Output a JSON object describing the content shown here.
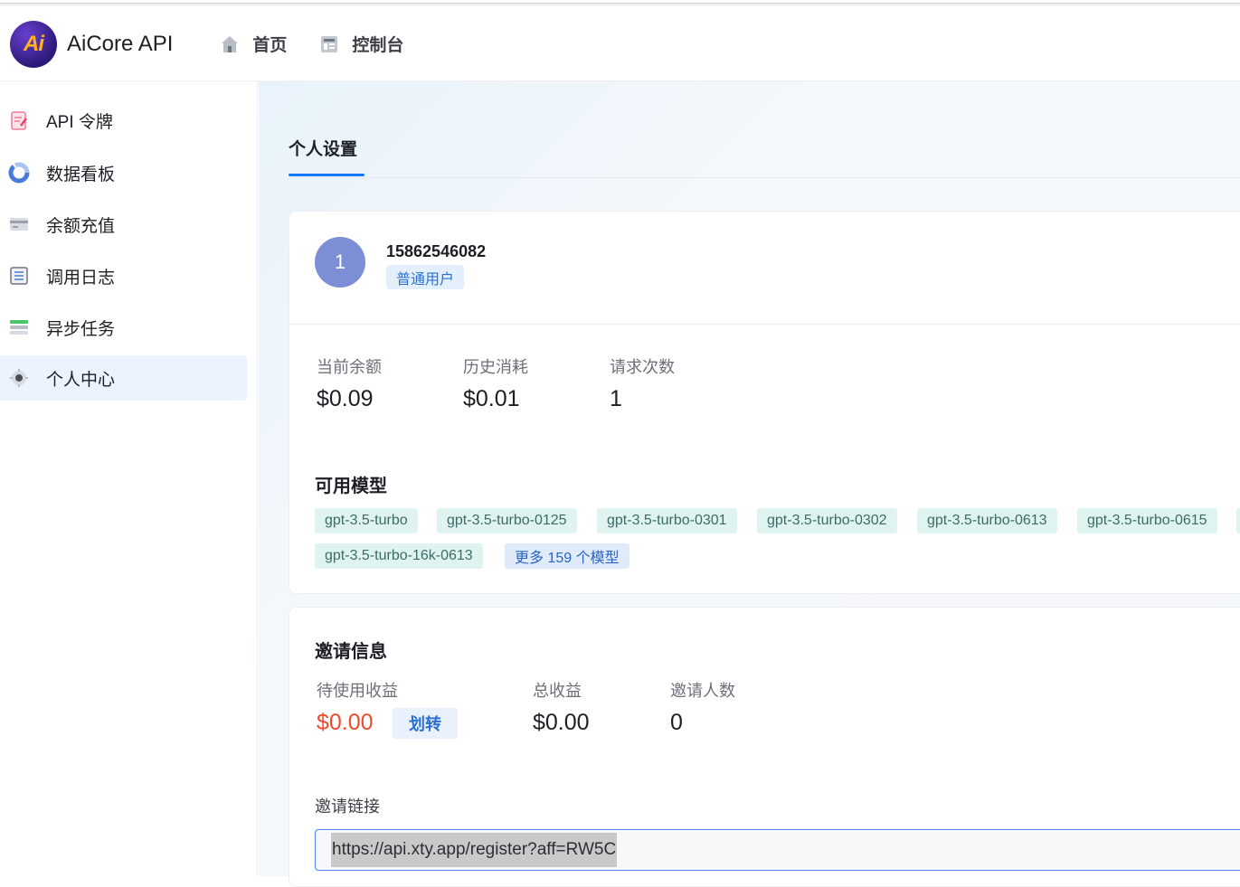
{
  "header": {
    "logo_text": "Ai",
    "brand": "AiCore API",
    "nav": [
      {
        "label": "首页",
        "icon": "home-icon"
      },
      {
        "label": "控制台",
        "icon": "console-icon"
      }
    ]
  },
  "sidebar": {
    "items": [
      {
        "label": "API 令牌",
        "icon": "token-icon",
        "active": false
      },
      {
        "label": "数据看板",
        "icon": "dashboard-icon",
        "active": false
      },
      {
        "label": "余额充值",
        "icon": "recharge-icon",
        "active": false
      },
      {
        "label": "调用日志",
        "icon": "log-icon",
        "active": false
      },
      {
        "label": "异步任务",
        "icon": "task-icon",
        "active": false
      },
      {
        "label": "个人中心",
        "icon": "profile-icon",
        "active": true
      }
    ]
  },
  "main": {
    "tab": "个人设置",
    "profile": {
      "avatar_initial": "1",
      "username": "15862546082",
      "role": "普通用户"
    },
    "stats": [
      {
        "label": "当前余额",
        "value": "$0.09"
      },
      {
        "label": "历史消耗",
        "value": "$0.01"
      },
      {
        "label": "请求次数",
        "value": "1"
      }
    ],
    "models": {
      "title": "可用模型",
      "tags": [
        "gpt-3.5-turbo",
        "gpt-3.5-turbo-0125",
        "gpt-3.5-turbo-0301",
        "gpt-3.5-turbo-0302",
        "gpt-3.5-turbo-0613",
        "gpt-3.5-turbo-0615",
        "gpt-3.5-turbo-16k-0613"
      ],
      "more": "更多 159 个模型"
    },
    "invite": {
      "title": "邀请信息",
      "stats": [
        {
          "label": "待使用收益",
          "value": "$0.00"
        },
        {
          "label": "总收益",
          "value": "$0.00"
        },
        {
          "label": "邀请人数",
          "value": "0"
        }
      ],
      "transfer_button": "划转",
      "link_label": "邀请链接",
      "link_value": "https://api.xty.app/register?aff=RW5C"
    }
  },
  "colors": {
    "accent": "#1677ff",
    "pending_income": "#f04a2b",
    "active_sidebar_bg": "#eaf3ff"
  }
}
